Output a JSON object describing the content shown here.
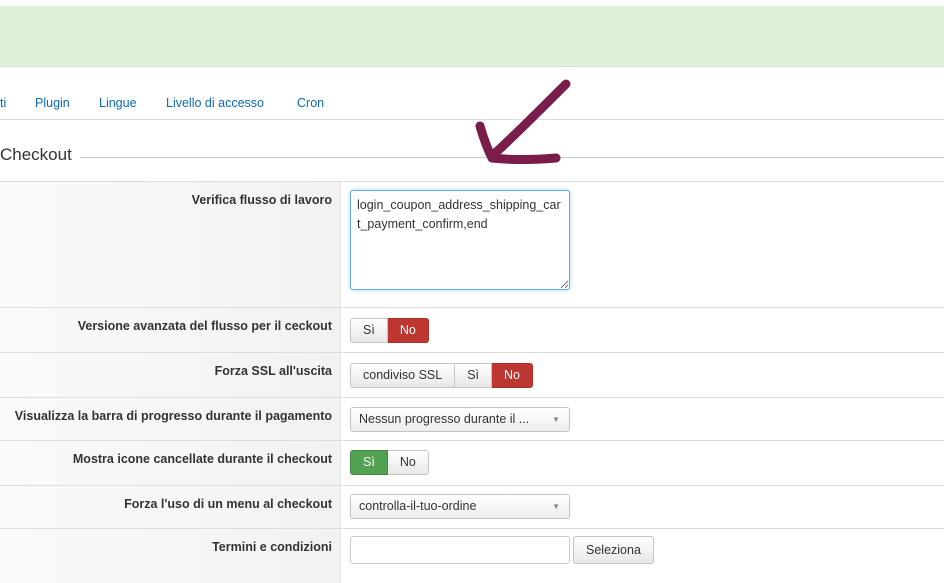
{
  "nav": {
    "items": [
      "ti",
      "Plugin",
      "Lingue",
      "Livello di accesso",
      "Cron"
    ]
  },
  "section": {
    "legend": "Checkout"
  },
  "fields": {
    "workflow": {
      "label": "Verifica flusso di lavoro",
      "value": "login_coupon_address_shipping_cart_payment_confirm,end"
    },
    "advanced_flow": {
      "label": "Versione avanzata del flusso per il ceckout",
      "yes": "Sì",
      "no": "No",
      "selected": "No"
    },
    "force_ssl": {
      "label": "Forza SSL all'uscita",
      "shared": "condiviso SSL",
      "yes": "Sì",
      "no": "No",
      "selected": "No"
    },
    "progress_bar": {
      "label": "Visualizza la barra di progresso durante il pagamento",
      "value": "Nessun progresso durante il ..."
    },
    "show_deleted_icons": {
      "label": "Mostra icone cancellate durante il checkout",
      "yes": "Sì",
      "no": "No",
      "selected": "Sì"
    },
    "force_menu": {
      "label": "Forza l'uso di un menu al checkout",
      "value": "controlla-il-tuo-ordine"
    },
    "terms": {
      "label": "Termini e condizioni",
      "value": "",
      "select_button": "Seleziona"
    }
  },
  "colors": {
    "accent_red": "#bd362f",
    "accent_green": "#51a351",
    "link": "#0a6ab8",
    "banner": "#dff0d8",
    "annotation": "#7a1d4a"
  }
}
